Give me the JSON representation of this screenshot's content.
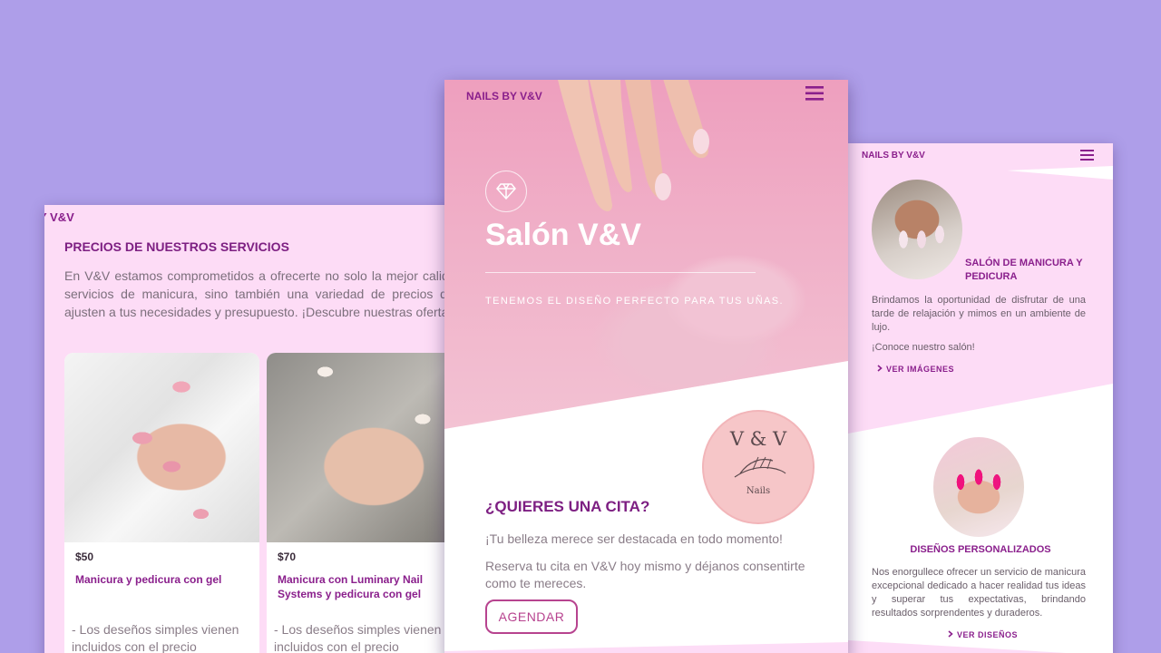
{
  "left_panel": {
    "brand": "Y V&V",
    "heading": "PRECIOS DE NUESTROS SERVICIOS",
    "intro": "En V&V estamos comprometidos a ofrecerte no solo la mejor calidad en servicios de manicura, sino también una variedad de precios que se ajusten a tus necesidades y presupuesto. ¡Descubre nuestras ofertas!",
    "cards": [
      {
        "price": "$50",
        "title": "Manicura y pedicura con gel",
        "desc": "- Los deseños simples vienen incluidos con el precio"
      },
      {
        "price": "$70",
        "title": "Manicura con Luminary Nail Systems y pedicura con gel",
        "desc": "- Los deseños simples vienen incluidos con el precio"
      }
    ]
  },
  "center_panel": {
    "brand": "NAILS BY V&V",
    "hero_title": "Salón V&V",
    "hero_subtitle": "TENEMOS EL DISEÑO PERFECTO PARA TUS UÑAS.",
    "logo_top": "V & V",
    "logo_bottom": "Nails",
    "cta_title": "¿QUIERES UNA CITA?",
    "cta_line1": "¡Tu belleza merece ser destacada en todo momento!",
    "cta_line2": "Reserva tu cita en V&V hoy mismo y déjanos consentirte como te mereces.",
    "cta_button": "AGENDAR"
  },
  "right_panel": {
    "brand": "NAILS BY V&V",
    "section1_title": "SALÓN DE MANICURA Y PEDICURA",
    "section1_p1": "Brindamos la oportunidad de disfrutar de una tarde de relajación y mimos en un ambiente de lujo.",
    "section1_p2": "¡Conoce nuestro salón!",
    "section1_link": "VER IMÁGENES",
    "section2_title": "DISEÑOS PERSONALIZADOS",
    "section2_p": "Nos enorgullece ofrecer un servicio de manicura excepcional dedicado a hacer realidad tus ideas y superar tus expectativas, brindando resultados sorprendentes y duraderos.",
    "section2_link": "VER DISEÑOS"
  },
  "colors": {
    "background": "#ae9ee9",
    "panel_pink": "#fddcf6",
    "brand_purple": "#8a1f8c",
    "button_magenta": "#b7438f"
  },
  "icons": [
    "menu-icon",
    "diamond-icon",
    "chevron-right-icon"
  ]
}
